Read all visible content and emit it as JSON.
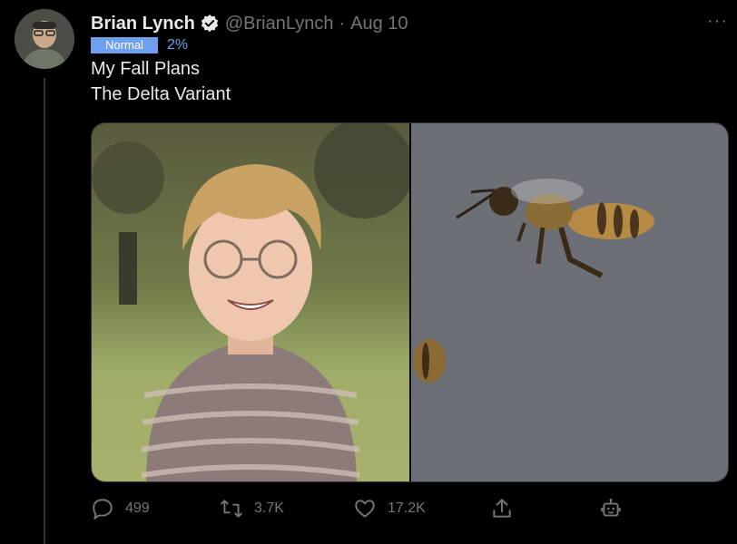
{
  "tweet": {
    "name": "Brian Lynch",
    "handle": "@BrianLynch",
    "separator": "·",
    "date": "Aug 10",
    "more": "···",
    "badge": "Normal",
    "percent": "2%",
    "lines": [
      "My Fall Plans",
      "The Delta Variant"
    ]
  },
  "icons": {
    "verified": "verified-badge-icon",
    "reply": "reply-icon",
    "retweet": "retweet-icon",
    "like": "like-icon",
    "share": "share-icon",
    "bot": "bot-icon"
  },
  "actions": {
    "replies": "499",
    "retweets": "3.7K",
    "likes": "17.2K"
  },
  "colors": {
    "background": "#000000",
    "text": "#e7e9ea",
    "muted": "#71767b",
    "badge": "#6ea0ef"
  }
}
